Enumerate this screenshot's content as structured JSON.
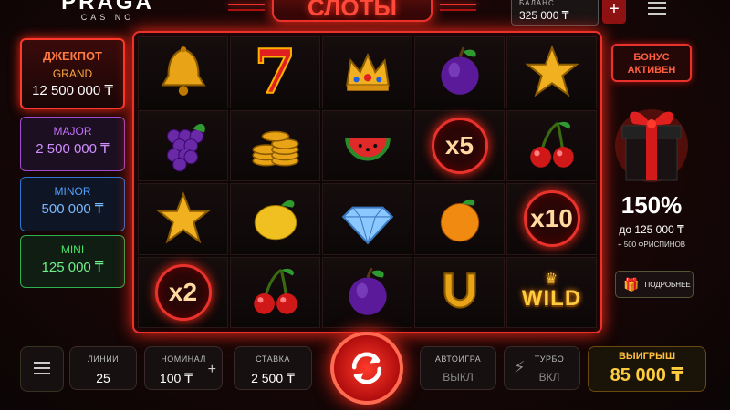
{
  "header": {
    "brand": "PRAGA",
    "brand_sub": "CASINO",
    "title": "СЛОТЫ",
    "balance_label": "БАЛАНС",
    "balance_value": "325 000 ₸",
    "add_label": "+"
  },
  "jackpots": {
    "main_title": "ДЖЕКПОТ",
    "grand_name": "GRAND",
    "grand_amount": "12 500 000 ₸",
    "major_name": "MAJOR",
    "major_amount": "2 500 000 ₸",
    "minor_name": "MINOR",
    "minor_amount": "500 000 ₸",
    "mini_name": "MINI",
    "mini_amount": "125 000 ₸"
  },
  "reels": {
    "symbols": [
      "bell",
      "seven",
      "crown",
      "plum",
      "star",
      "grapes",
      "coins",
      "watermelon",
      "x5",
      "cherry",
      "star",
      "lemon",
      "diamond",
      "orange",
      "x10",
      "x2",
      "cherry",
      "plum",
      "horseshoe",
      "wild"
    ],
    "x5_label": "x5",
    "x10_label": "x10",
    "x2_label": "x2",
    "seven_label": "7",
    "wild_label": "WILD"
  },
  "bonus": {
    "badge_line1": "БОНУС",
    "badge_line2": "АКТИВЕН",
    "percent": "150%",
    "up_to": "до 125 000 ₸",
    "freespins": "+ 500 ФРИСПИНОВ",
    "more_label": "ПОДРОБНЕЕ"
  },
  "controls": {
    "lines_label": "ЛИНИИ",
    "lines_value": "25",
    "nominal_label": "НОМИНАЛ",
    "nominal_value": "100 ₸",
    "nominal_plus": "+",
    "bet_label": "СТАВКА",
    "bet_value": "2 500 ₸",
    "auto_label": "АВТОИГРА",
    "auto_value": "ВЫКЛ",
    "turbo_label": "ТУРБО",
    "turbo_value": "ВКЛ",
    "win_label": "ВЫИГРЫШ",
    "win_value": "85 000 ₸"
  },
  "colors": {
    "accent": "#e8332c",
    "gold": "#ffcc40",
    "major": "#c670ff",
    "minor": "#50a0ff",
    "mini": "#4ce06a"
  }
}
